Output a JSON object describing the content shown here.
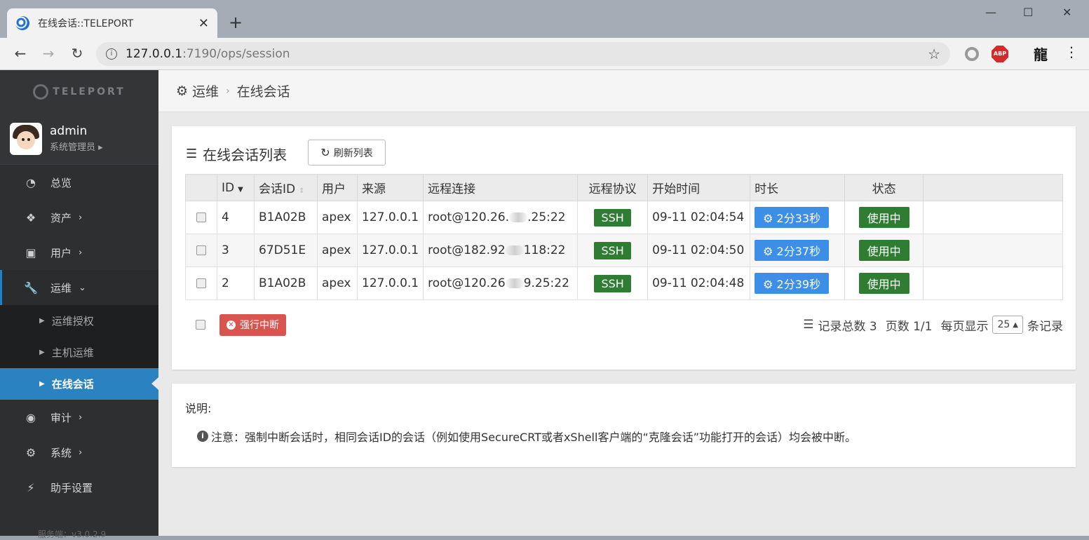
{
  "browser": {
    "tab_title": "在线会话::TELEPORT",
    "url_host": "127.0.0.1",
    "url_rest": ":7190/ops/session",
    "ext_abp": "ABP",
    "ext_dragon": "龍"
  },
  "sidebar": {
    "logo_text": "TELEPORT",
    "user_name": "admin",
    "user_role": "系统管理员",
    "items": [
      {
        "label": "总览",
        "icon": "dashboard-icon"
      },
      {
        "label": "资产",
        "icon": "cubes-icon"
      },
      {
        "label": "用户",
        "icon": "address-book-icon"
      },
      {
        "label": "运维",
        "icon": "wrench-icon"
      },
      {
        "label": "审计",
        "icon": "eye-icon"
      },
      {
        "label": "系统",
        "icon": "gear-icon"
      },
      {
        "label": "助手设置",
        "icon": "bolt-icon"
      }
    ],
    "sub_items": [
      {
        "label": "运维授权"
      },
      {
        "label": "主机运维"
      },
      {
        "label": "在线会话"
      }
    ],
    "version": "服务端：v3.0.2.9"
  },
  "breadcrumb": {
    "root": "运维",
    "current": "在线会话"
  },
  "panel": {
    "title": "在线会话列表",
    "refresh_label": "刷新列表",
    "columns": [
      "ID",
      "会话ID",
      "用户",
      "来源",
      "远程连接",
      "远程协议",
      "开始时间",
      "时长",
      "状态"
    ],
    "rows": [
      {
        "id": "4",
        "sid": "B1A02B",
        "user": "apex",
        "source": "127.0.0.1",
        "conn_a": "root@120.26.",
        "conn_b": ".25:22",
        "protocol": "SSH",
        "start": "09-11 02:04:54",
        "duration": "2分33秒",
        "status": "使用中"
      },
      {
        "id": "3",
        "sid": "67D51E",
        "user": "apex",
        "source": "127.0.0.1",
        "conn_a": "root@182.92",
        "conn_b": "118:22",
        "protocol": "SSH",
        "start": "09-11 02:04:50",
        "duration": "2分37秒",
        "status": "使用中"
      },
      {
        "id": "2",
        "sid": "B1A02B",
        "user": "apex",
        "source": "127.0.0.1",
        "conn_a": "root@120.26",
        "conn_b": "9.25:22",
        "protocol": "SSH",
        "start": "09-11 02:04:48",
        "duration": "2分39秒",
        "status": "使用中"
      }
    ],
    "kill_label": "强行中断",
    "total_label": "记录总数 3",
    "pages_label": "页数 1/1",
    "perpage_prefix": "每页显示",
    "perpage_value": "25",
    "perpage_suffix": "条记录"
  },
  "notes": {
    "title": "说明:",
    "text": "注意：强制中断会话时，相同会话ID的会话（例如使用SecureCRT或者xShell客户端的“克隆会话”功能打开的会话）均会被中断。"
  },
  "colors": {
    "accent": "#2a82c0",
    "ssh": "#2e7d32",
    "duration": "#3d8ee6",
    "danger": "#d9534f"
  }
}
